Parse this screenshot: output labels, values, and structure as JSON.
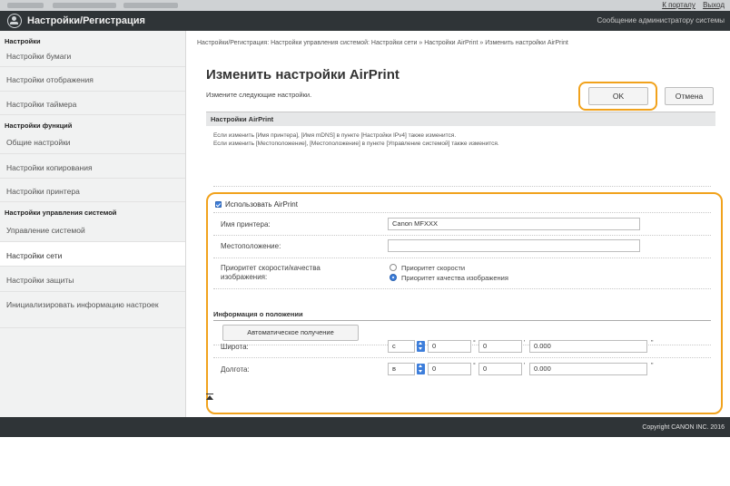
{
  "top_links": {
    "portal": "К порталу",
    "logout": "Выход"
  },
  "header": {
    "title": "Настройки/Регистрация",
    "admin_message": "Сообщение администратору системы"
  },
  "sidebar": {
    "sections": [
      {
        "title": "Настройки",
        "items": [
          "Настройки бумаги",
          "Настройки отображения",
          "Настройки таймера"
        ]
      },
      {
        "title": "Настройки функций",
        "items": [
          "Общие настройки",
          "Настройки копирования",
          "Настройки принтера"
        ]
      },
      {
        "title": "Настройки управления системой",
        "items": [
          "Управление системой",
          "Настройки сети",
          "Настройки защиты",
          "Инициализировать информацию настроек"
        ]
      }
    ],
    "active": "Настройки сети"
  },
  "main": {
    "breadcrumb": "Настройки/Регистрация: Настройки управления системой: Настройки сети » Настройки AirPrint » Изменить настройки AirPrint",
    "title": "Изменить настройки AirPrint",
    "instruction": "Измените следующие настройки.",
    "ok_label": "OK",
    "cancel_label": "Отмена",
    "section_title": "Настройки AirPrint",
    "note_line1": "Если изменить [Имя принтера], [Имя mDNS] в пункте [Настройки IPv4] также изменится.",
    "note_line2": "Если изменить [Местоположение], [Местоположение] в пункте [Управление системой] также изменится.",
    "use_airprint": {
      "label": "Использовать AirPrint",
      "checked": true
    },
    "printer_name": {
      "label": "Имя принтера:",
      "value": "Canon MFXXX"
    },
    "location": {
      "label": "Местоположение:",
      "value": ""
    },
    "priority": {
      "label_line1": "Приоритет скорости/качества",
      "label_line2": "изображения:",
      "options": [
        "Приоритет скорости",
        "Приоритет качества изображения"
      ],
      "selected": "Приоритет качества изображения"
    },
    "position_info": {
      "title": "Информация о положении",
      "auto_button": "Автоматическое получение",
      "latitude": {
        "label": "Широта:",
        "direction": "с",
        "deg": "0",
        "min": "0",
        "sec": "0.000"
      },
      "longitude": {
        "label": "Долгота:",
        "direction": "в",
        "deg": "0",
        "min": "0",
        "sec": "0.000"
      },
      "unit_deg": "°",
      "unit_min": "'",
      "unit_sec": "\""
    }
  },
  "footer": {
    "copyright": "Copyright CANON INC. 2016"
  },
  "colors": {
    "highlight": "#f1a21c",
    "header_bg": "#2f3437",
    "accent": "#3d7edb"
  }
}
